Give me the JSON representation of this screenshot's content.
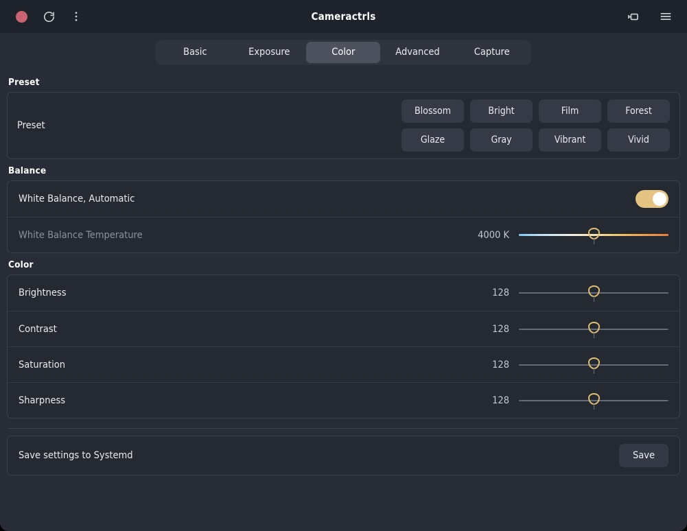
{
  "window": {
    "title": "Cameractrls",
    "accent_color": "#e5c483",
    "background_color": "#282c36",
    "header_color": "#1e222b",
    "record_color": "#cc6373"
  },
  "header": {
    "record_button": "record-indicator",
    "reload_button": "reload",
    "menu_button": "more-options",
    "camera_button": "camera-device",
    "hamburger_button": "main-menu"
  },
  "tabs": [
    {
      "label": "Basic",
      "active": false
    },
    {
      "label": "Exposure",
      "active": false
    },
    {
      "label": "Color",
      "active": true
    },
    {
      "label": "Advanced",
      "active": false
    },
    {
      "label": "Capture",
      "active": false
    }
  ],
  "sections": {
    "preset": {
      "title": "Preset",
      "row_label": "Preset",
      "buttons": [
        "Blossom",
        "Bright",
        "Film",
        "Forest",
        "Glaze",
        "Gray",
        "Vibrant",
        "Vivid"
      ]
    },
    "balance": {
      "title": "Balance",
      "white_balance_auto": {
        "label": "White Balance, Automatic",
        "state": "on"
      },
      "white_balance_temperature": {
        "label": "White Balance Temperature",
        "value": "4000 K",
        "position_percent": 50,
        "disabled": true
      }
    },
    "color": {
      "title": "Color",
      "controls": [
        {
          "label": "Brightness",
          "value": "128",
          "position_percent": 50
        },
        {
          "label": "Contrast",
          "value": "128",
          "position_percent": 50
        },
        {
          "label": "Saturation",
          "value": "128",
          "position_percent": 50
        },
        {
          "label": "Sharpness",
          "value": "128",
          "position_percent": 50
        }
      ]
    },
    "save": {
      "label": "Save settings to Systemd",
      "button_label": "Save"
    }
  }
}
